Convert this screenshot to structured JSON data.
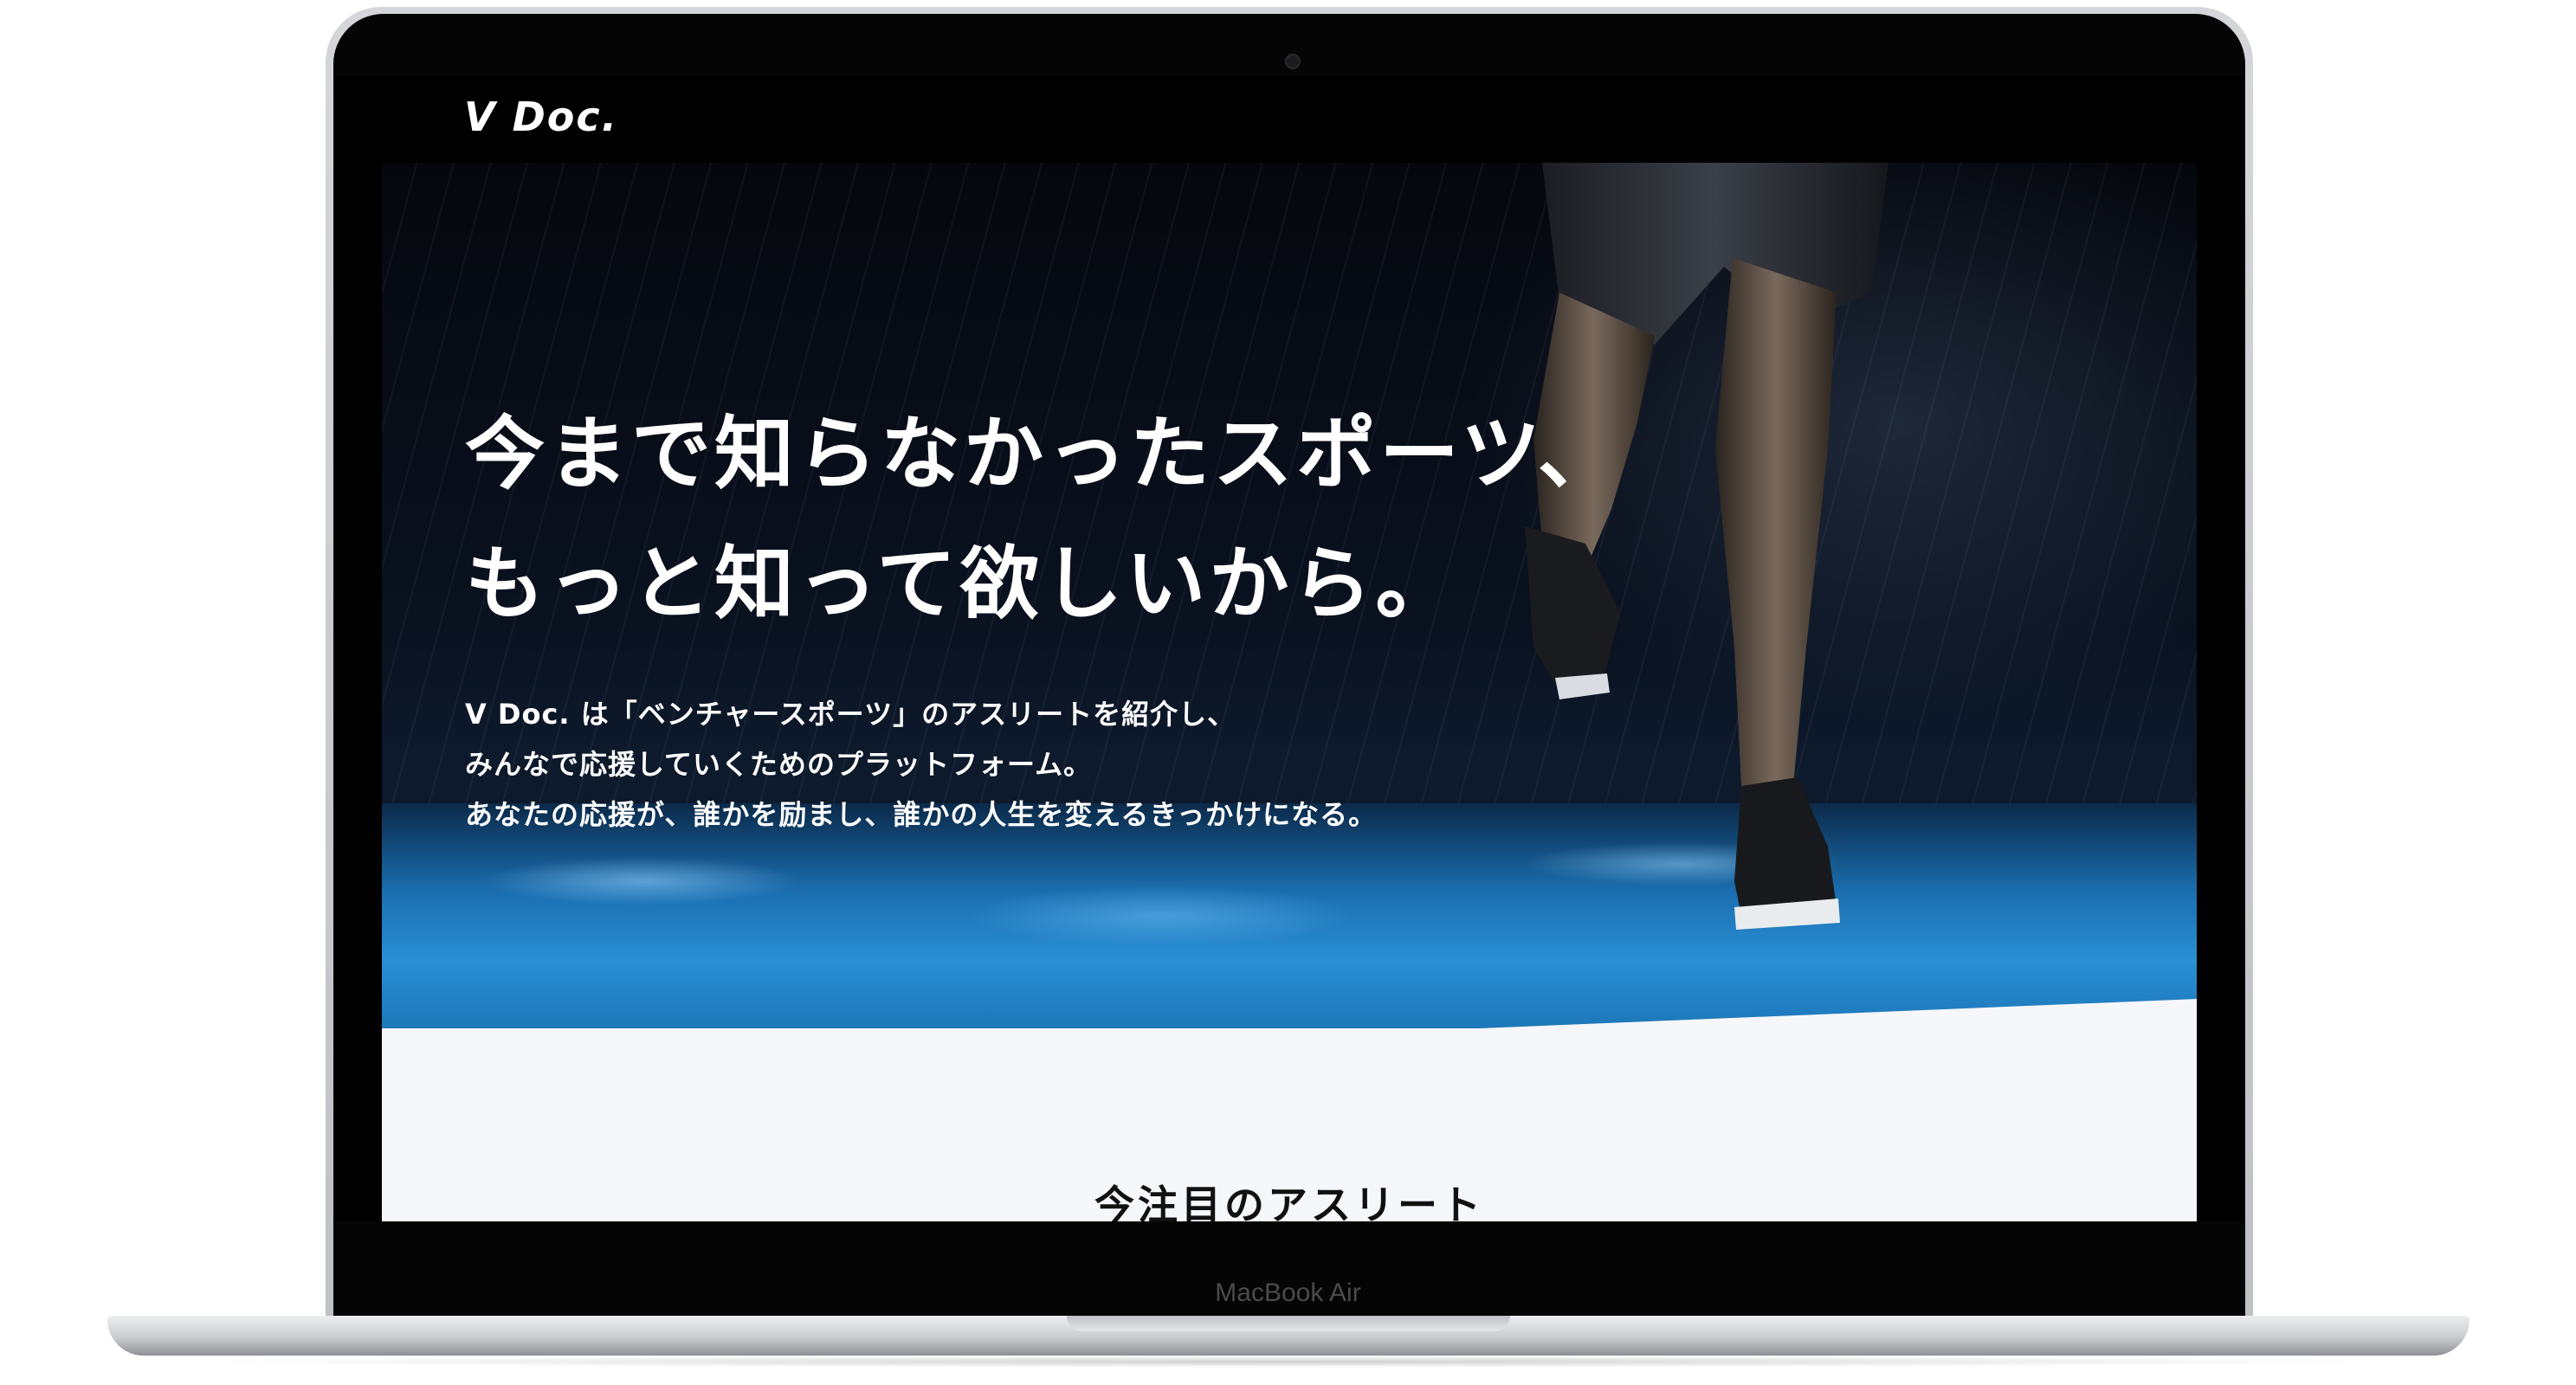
{
  "site": {
    "logo": "V Doc."
  },
  "hero": {
    "headline_lines": [
      "今まで知らなかったスポーツ、",
      "もっと知って欲しいから。"
    ],
    "lead_lines": [
      "V Doc. は「ベンチャースポーツ」のアスリートを紹介し、",
      "みんなで応援していくためのプラットフォーム。",
      "あなたの応援が、誰かを励まし、誰かの人生を変えるきっかけになる。"
    ]
  },
  "section": {
    "title": "今注目のアスリート"
  },
  "device": {
    "label": "MacBook Air"
  },
  "colors": {
    "hero_bg": "#05070d",
    "water_blue": "#2a8fd4",
    "page_bg": "#f5f7fb",
    "text_dark": "#111111"
  }
}
